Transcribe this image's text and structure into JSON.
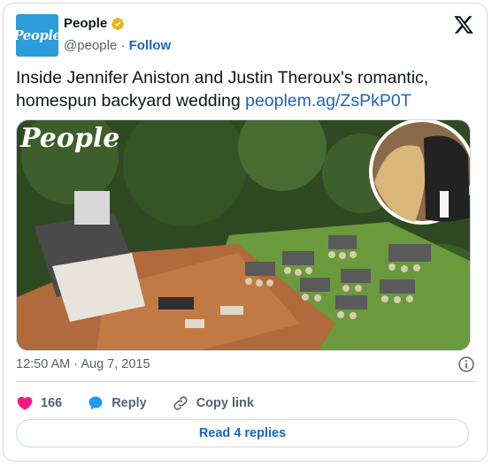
{
  "author": {
    "name": "People",
    "handle": "@people",
    "separator": "·",
    "follow_label": "Follow",
    "avatar_text": "People",
    "verified_color": "#e2b719"
  },
  "tweet": {
    "text": "Inside Jennifer Aniston and Justin Theroux's romantic, homespun backyard wedding ",
    "link": "peoplem.ag/ZsPkP0T"
  },
  "media": {
    "watermark": "People",
    "alt_icon": "aerial-wedding-photo"
  },
  "meta": {
    "timestamp": "12:50 AM · Aug 7, 2015"
  },
  "actions": {
    "likes": "166",
    "reply_label": "Reply",
    "copy_label": "Copy link",
    "like_color": "#f91880",
    "reply_color": "#1d9bf0"
  },
  "replies_button": {
    "label": "Read 4 replies"
  },
  "colors": {
    "accent": "#1d64b8",
    "border": "#cfd9de",
    "muted": "#536471"
  }
}
